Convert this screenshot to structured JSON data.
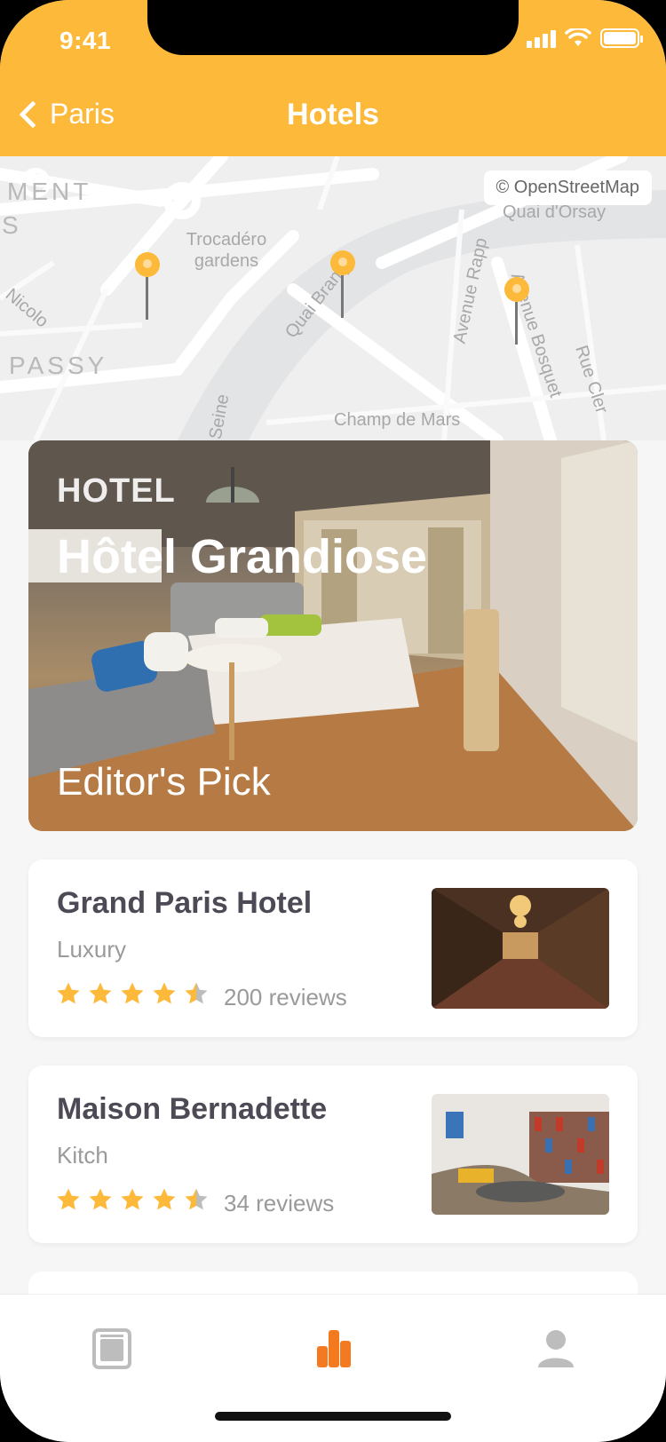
{
  "status_bar": {
    "time": "9:41"
  },
  "header": {
    "back_label": "Paris",
    "title": "Hotels",
    "background_color": "#fdb93a"
  },
  "map": {
    "attribution": "© OpenStreetMap",
    "labels": {
      "ment": "MENT",
      "s": "S",
      "trocadero": "Trocadéro gardens",
      "quai_orsay": "Quai d'Orsay",
      "nicolo": "Nicolo",
      "passy": "PASSY",
      "quai_branly": "Quai Branly",
      "avenue_rapp": "Avenue Rapp",
      "avenue_bosquet": "Avenue Bosquet",
      "rue_cler": "Rue Cler",
      "champ_de_mars": "Champ de Mars",
      "seine": "Seine"
    },
    "pin_color": "#fdb93a"
  },
  "featured": {
    "kicker": "HOTEL",
    "title": "Hôtel Grandiose",
    "footer": "Editor's Pick"
  },
  "hotels": [
    {
      "name": "Grand Paris Hotel",
      "category": "Luxury",
      "rating": 4.5,
      "reviews": "200 reviews"
    },
    {
      "name": "Maison Bernadette",
      "category": "Kitch",
      "rating": 4.5,
      "reviews": "34 reviews"
    }
  ],
  "tabbar": {
    "tabs": [
      {
        "icon": "document-icon",
        "active": false
      },
      {
        "icon": "chart-icon",
        "active": true
      },
      {
        "icon": "profile-icon",
        "active": false
      }
    ],
    "active_color": "#f47a20",
    "inactive_color": "#bdbdbd"
  },
  "colors": {
    "star": "#fdb93a",
    "star_empty": "#bdbdbd"
  }
}
